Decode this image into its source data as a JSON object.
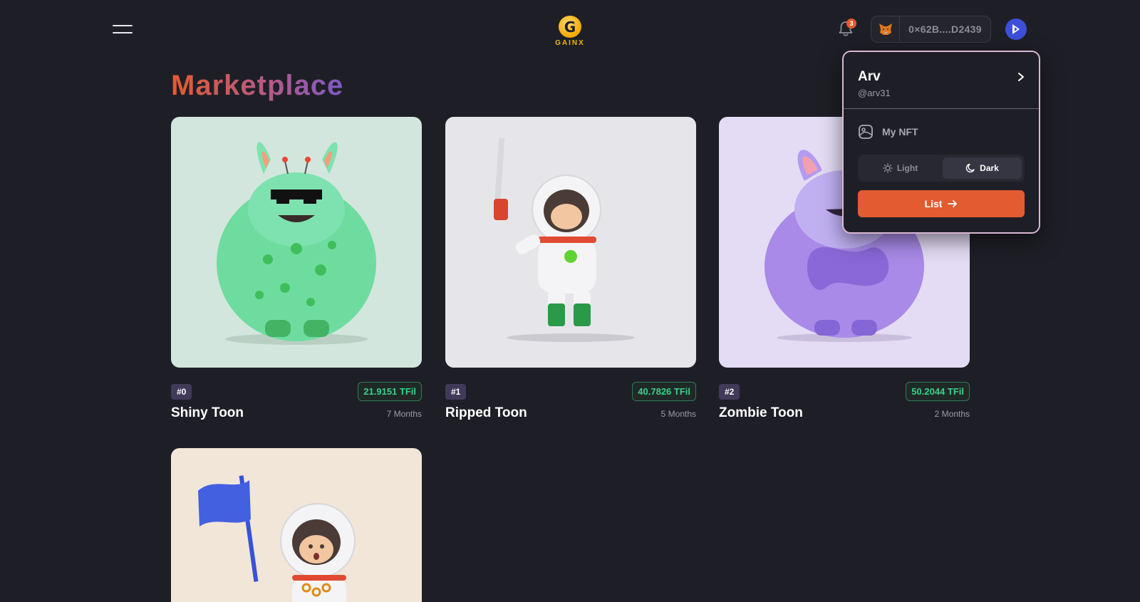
{
  "header": {
    "logo_text": "GAINX",
    "logo_letter": "G",
    "notification_count": "3",
    "wallet_address": "0×62B....D2439"
  },
  "page": {
    "title": "Marketplace"
  },
  "nfts": [
    {
      "tag": "#0",
      "price": "21.9151 TFil",
      "name": "Shiny Toon",
      "age": "7 Months"
    },
    {
      "tag": "#1",
      "price": "40.7826 TFil",
      "name": "Ripped Toon",
      "age": "5 Months"
    },
    {
      "tag": "#2",
      "price": "50.2044 TFil",
      "name": "Zombie Toon",
      "age": "2 Months"
    }
  ],
  "dropdown": {
    "name": "Arv",
    "handle": "@arv31",
    "my_nft": "My NFT",
    "theme_light": "Light",
    "theme_dark": "Dark",
    "list_button": "List"
  },
  "colors": {
    "background": "#1e1f26",
    "accent": "#e35b31",
    "price_green": "#3ccf8a",
    "card_bg_0": "#d3e6dd",
    "card_bg_1": "#e6e6ea",
    "card_bg_2": "#e4dcf4",
    "card_bg_3": "#f1e6d8"
  },
  "icons": [
    "menu-icon",
    "bell-icon",
    "metamask-fox-icon",
    "avatar-icon",
    "chevron-right-icon",
    "image-icon",
    "sun-icon",
    "moon-icon",
    "arrow-right-icon"
  ]
}
